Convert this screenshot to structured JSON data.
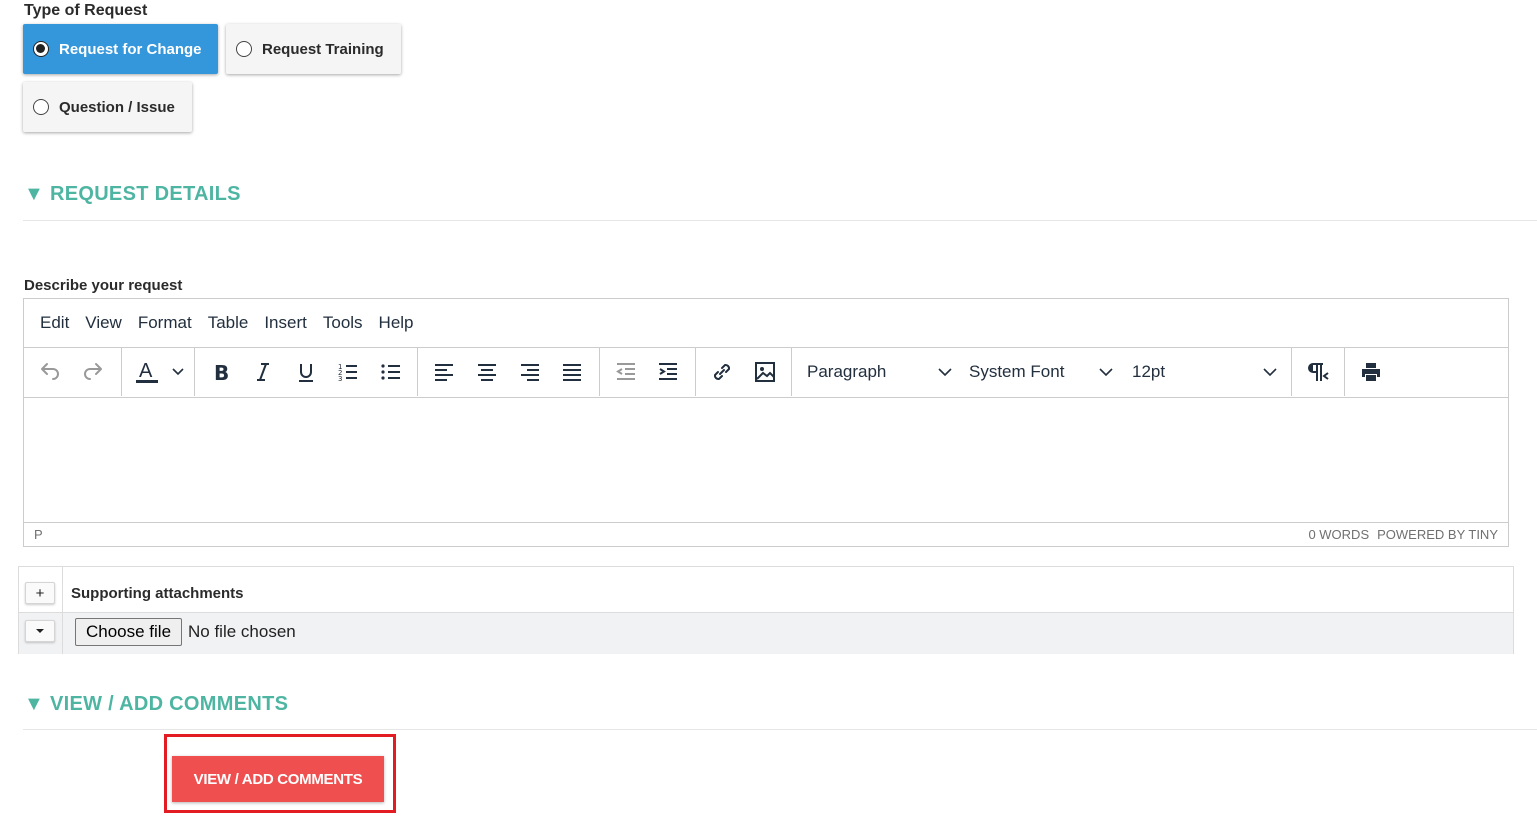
{
  "type_of_request": {
    "label": "Type of Request",
    "options": [
      {
        "label": "Request for Change",
        "selected": true
      },
      {
        "label": "Request Training",
        "selected": false
      },
      {
        "label": "Question / Issue",
        "selected": false
      }
    ]
  },
  "request_details": {
    "heading": "▼ REQUEST DETAILS",
    "describe_label": "Describe your request"
  },
  "editor": {
    "menu": [
      "Edit",
      "View",
      "Format",
      "Table",
      "Insert",
      "Tools",
      "Help"
    ],
    "block_format": "Paragraph",
    "font_family": "System Font",
    "font_size": "12pt",
    "status_path": "P",
    "word_count": "0 WORDS",
    "branding": "POWERED BY TINY"
  },
  "attachments": {
    "add_label": "+",
    "title": "Supporting attachments",
    "file_button": "Choose file",
    "file_status": "No file chosen"
  },
  "comments": {
    "heading": "▼ VIEW / ADD COMMENTS",
    "button_label": "VIEW / ADD COMMENTS"
  },
  "colors": {
    "accent_teal": "#4eb5a2",
    "selected_blue": "#3597db",
    "comments_red": "#ef4f4f",
    "highlight_red": "#e31b23"
  },
  "icons": {
    "toolbar": [
      "undo-icon",
      "redo-icon",
      "text-color-icon",
      "bold-icon",
      "italic-icon",
      "underline-icon",
      "numbered-list-icon",
      "bullet-list-icon",
      "align-left-icon",
      "align-center-icon",
      "align-right-icon",
      "align-justify-icon",
      "outdent-icon",
      "indent-icon",
      "link-icon",
      "image-icon",
      "paragraph-direction-icon",
      "print-icon"
    ]
  }
}
